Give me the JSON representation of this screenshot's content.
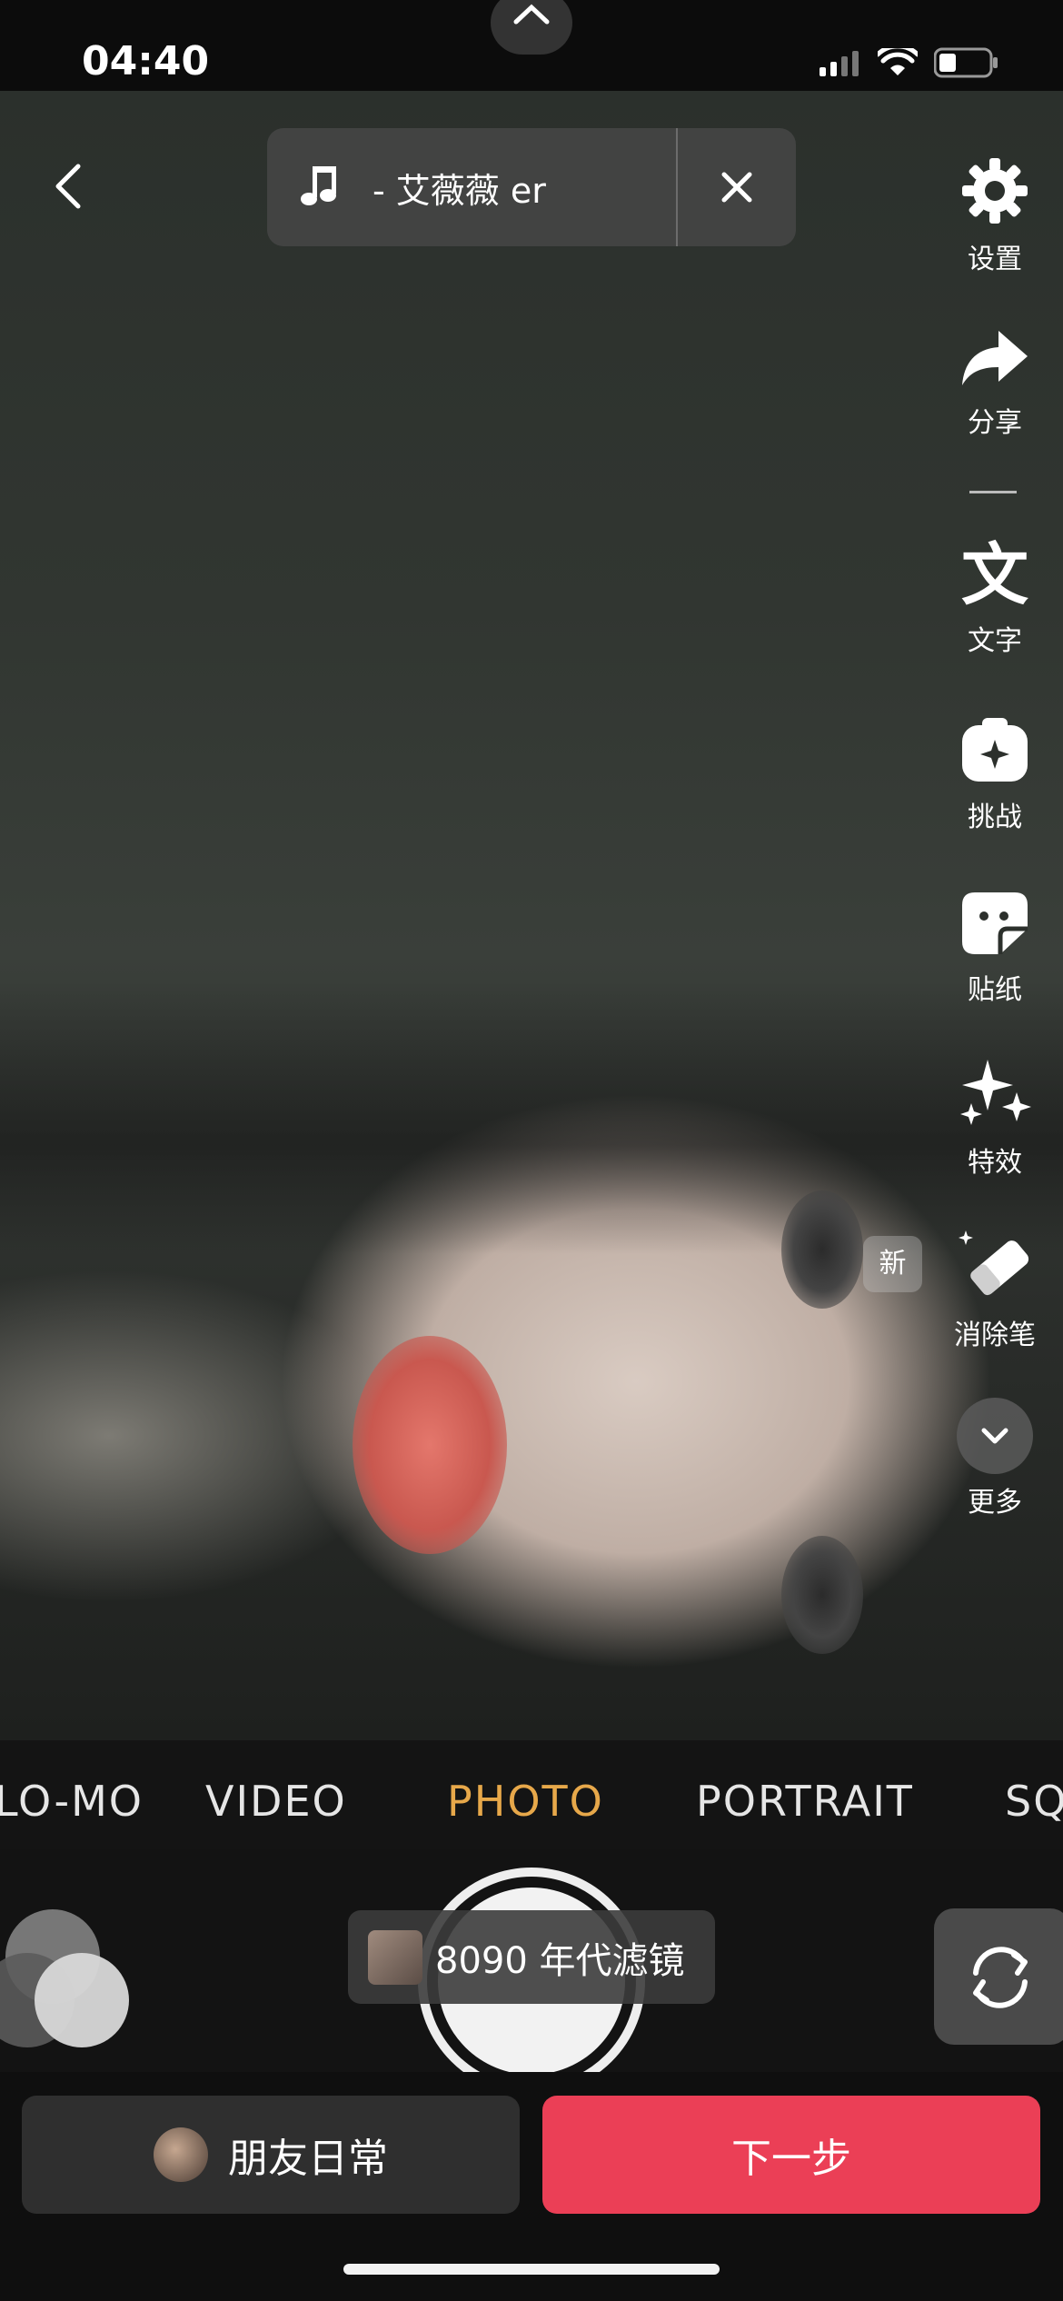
{
  "status": {
    "time": "04:40"
  },
  "music": {
    "title": "- 艾薇薇 er"
  },
  "side_menu": {
    "settings": "设置",
    "share": "分享",
    "text": "文字",
    "challenge": "挑战",
    "sticker": "贴纸",
    "effects": "特效",
    "eraser": "消除笔",
    "more": "更多",
    "new_badge": "新"
  },
  "modes": [
    "LO-MO",
    "VIDEO",
    "PHOTO",
    "PORTRAIT",
    "SQ"
  ],
  "active_mode": "PHOTO",
  "filter": {
    "name": "8090 年代滤镜"
  },
  "bottom": {
    "friends_label": "朋友日常",
    "next_label": "下一步"
  },
  "colors": {
    "accent": "#eb3f56",
    "active_mode": "#e7a84a"
  }
}
